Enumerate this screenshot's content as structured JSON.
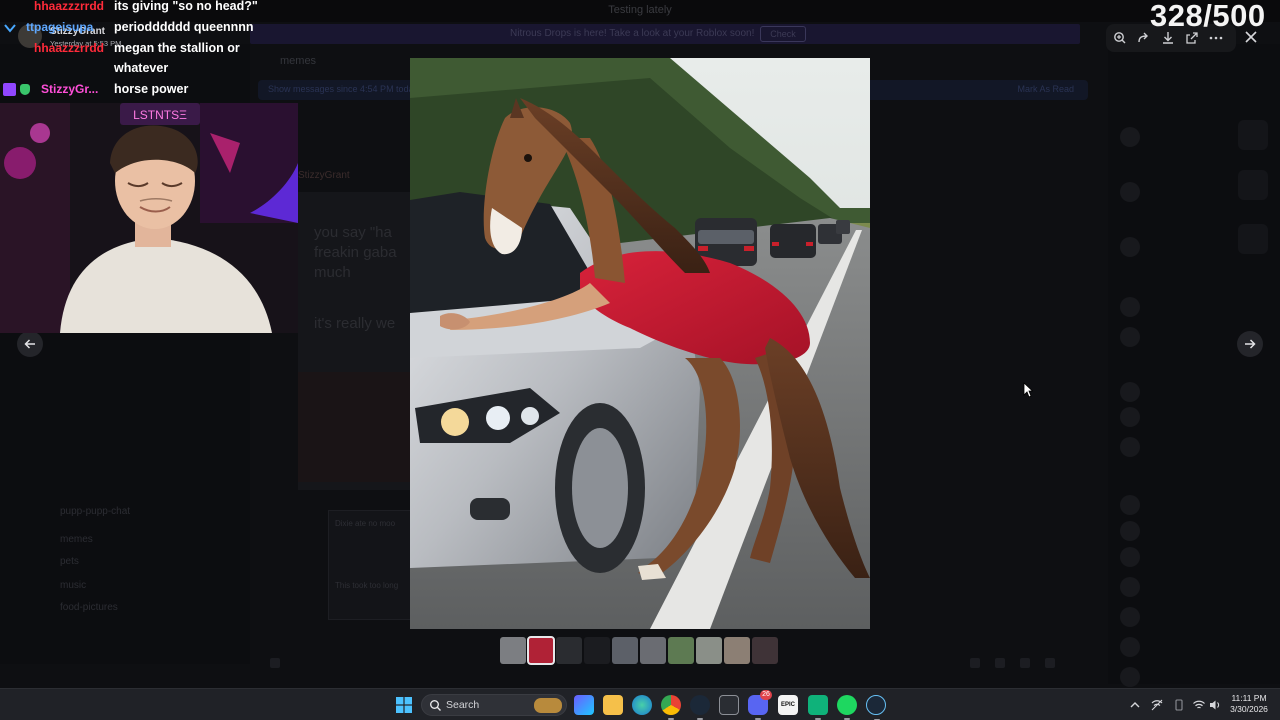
{
  "stream_overlay": {
    "counter": "328/500",
    "chat": [
      {
        "user": "hhaazzzrrdd",
        "text": "its giving \"so no head?\"",
        "user_color": "#ff2b3a"
      },
      {
        "user": "ttpageisupa",
        "text": "periodddddd queennnn",
        "user_color": "#5fa8ff"
      },
      {
        "user": "hhaazzzrrdd",
        "text": "megan the stallion or",
        "user_color": "#ff2b3a"
      },
      {
        "user": "",
        "text": "whatever",
        "user_color": "#ffffff"
      },
      {
        "user": "StizzyGr...",
        "text": "horse power",
        "user_color": "#ff4fd8"
      }
    ],
    "discord_ghost": {
      "name": "StizzyGrant",
      "time": "Yesterday at 5:53 PM"
    }
  },
  "app_background": {
    "window_title": "Testing lately",
    "banner_text": "Nitrous Drops is here! Take a look at your Roblox soon!",
    "banner_button": "Check",
    "channel_name": "memes",
    "notice_text": "Show messages since 4:54 PM today",
    "notice_action": "Mark As Read",
    "chat_author": "StizzyGrant",
    "chat_lines": [
      "you say \"ha",
      "freakin gaba",
      "much",
      "it's really we"
    ],
    "quote_lines": [
      "Dixie ate no moo",
      "This took too long"
    ],
    "channels": [
      "pupp-pupp-chat",
      "memes",
      "pets",
      "music",
      "food-pictures"
    ]
  },
  "lightbox": {
    "image_alt": "Horse-headed figure in red dress leaning on a silver car on a highway",
    "thumbnails": 10,
    "active_thumbnail": 1,
    "tools": [
      "zoom-icon",
      "share-icon",
      "download-icon",
      "open-icon",
      "more-icon"
    ]
  },
  "taskbar": {
    "search_placeholder": "Search",
    "time": "11:11 PM",
    "date": "3/30/2026",
    "discord_badge": "26"
  }
}
